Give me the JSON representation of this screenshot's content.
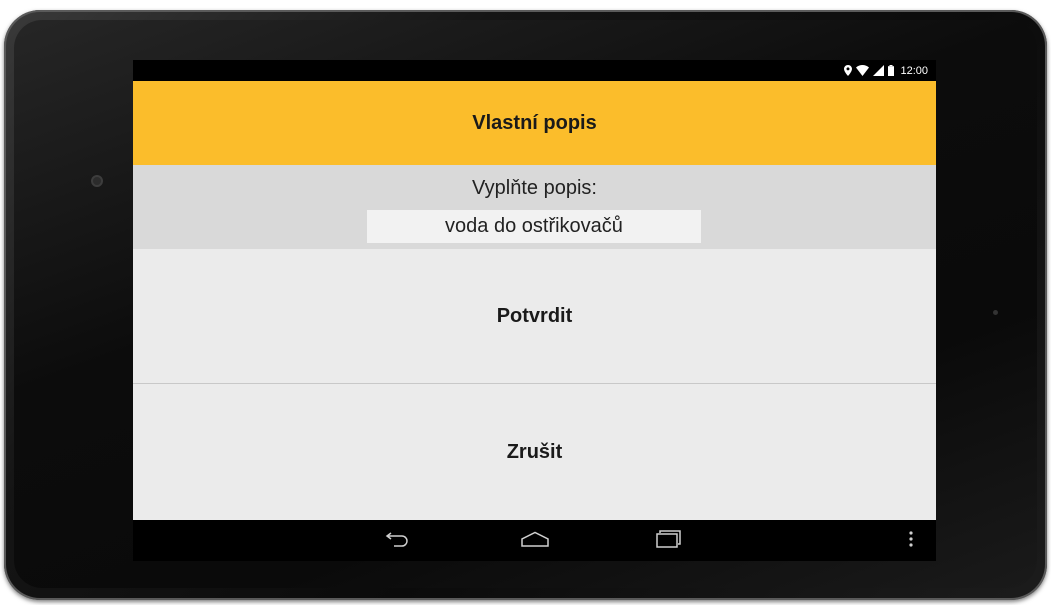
{
  "status_bar": {
    "time": "12:00",
    "icons": [
      "location-icon",
      "wifi-icon",
      "signal-icon",
      "battery-icon"
    ]
  },
  "action_bar": {
    "title": "Vlastní popis",
    "color": "#fbbd2b"
  },
  "form": {
    "label": "Vyplňte popis:",
    "input_value": "voda do ostřikovačů"
  },
  "buttons": {
    "confirm_label": "Potvrdit",
    "cancel_label": "Zrušit"
  },
  "nav_bar": {
    "icons": [
      "back-icon",
      "home-icon",
      "recent-apps-icon",
      "overflow-menu-icon"
    ]
  }
}
